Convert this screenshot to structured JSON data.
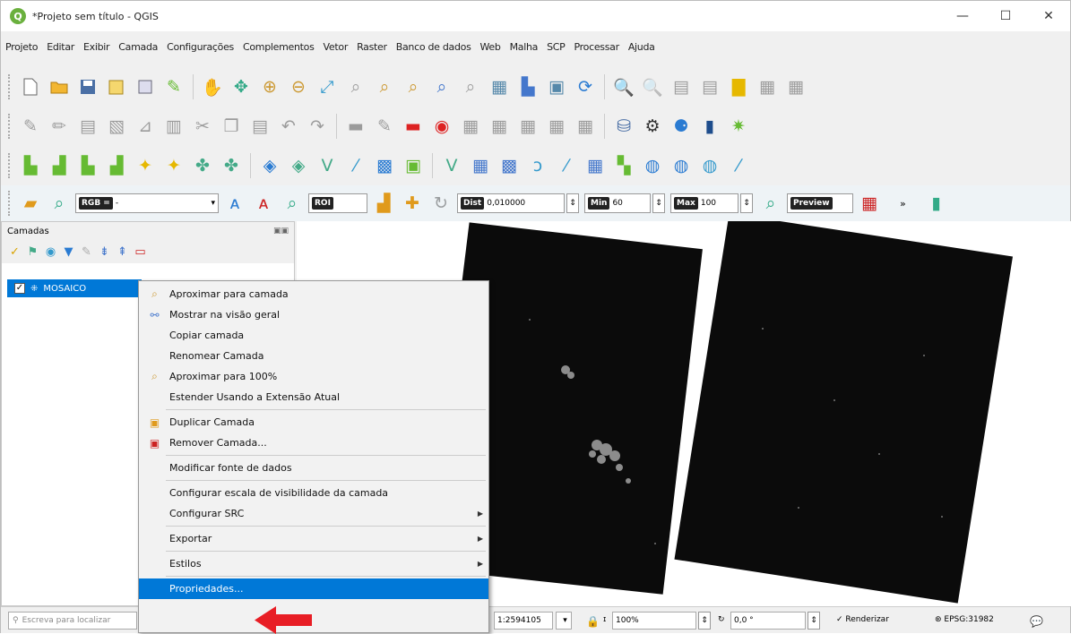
{
  "window": {
    "title": "*Projeto sem título - QGIS",
    "minimize": "—",
    "maximize": "☐",
    "close": "✕"
  },
  "menubar": [
    "Projeto",
    "Editar",
    "Exibir",
    "Camada",
    "Configurações",
    "Complementos",
    "Vetor",
    "Raster",
    "Banco de dados",
    "Web",
    "Malha",
    "SCP",
    "Processar",
    "Ajuda"
  ],
  "toolbar4": {
    "rgb_label": "RGB =",
    "rgb_value": "-",
    "roi_label": "ROI",
    "dist_label": "Dist",
    "dist_value": "0,010000",
    "min_label": "Min",
    "min_value": "60",
    "max_label": "Max",
    "max_value": "100",
    "preview_label": "Preview",
    "overflow": "»"
  },
  "layers": {
    "title": "Camadas",
    "layer_name": "MOSAICO",
    "checked": "✓"
  },
  "context_menu": {
    "items": [
      "Aproximar para camada",
      "Mostrar na visão geral",
      "Copiar camada",
      "Renomear Camada",
      "Aproximar para 100%",
      "Estender Usando a Extensão Atual",
      "Duplicar Camada",
      "Remover Camada...",
      "Modificar fonte de dados",
      "Configurar escala de visibilidade da camada",
      "Configurar SRC",
      "Exportar",
      "Estilos",
      "Propriedades..."
    ],
    "highlighted": "Propriedades..."
  },
  "status": {
    "locator_placeholder": "Escreva para localizar",
    "scale": "1:2594105",
    "magnifier": "100%",
    "rotation": "0,0 °",
    "render": "Renderizar",
    "crs": "EPSG:31982"
  },
  "colors": {
    "accent": "#0078d7",
    "arrow": "#e81e25",
    "raster": "#0b0b0b",
    "qgis_green": "#6ab03d"
  }
}
